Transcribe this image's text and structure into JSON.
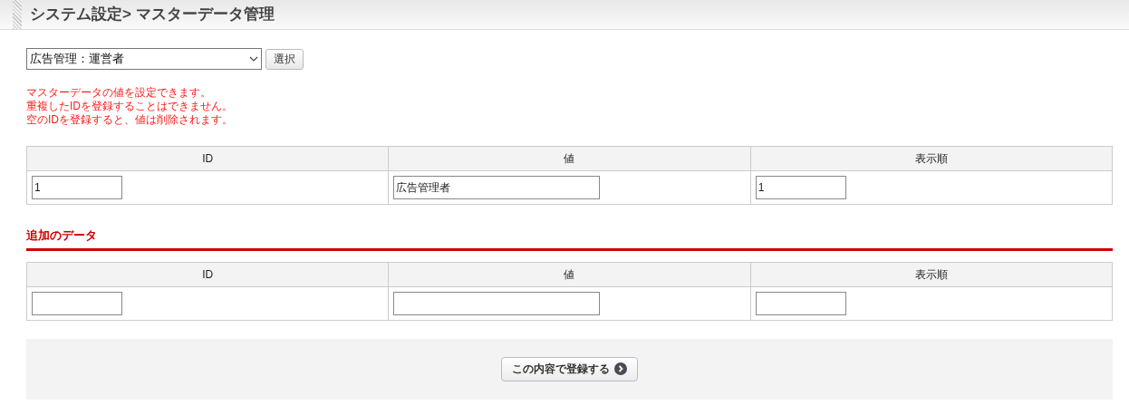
{
  "header": {
    "title": "システム設定> マスターデータ管理"
  },
  "selector": {
    "value": "広告管理：運営者",
    "button": "選択"
  },
  "notes": [
    "マスターデータの値を設定できます。",
    "重複したIDを登録することはできません。",
    "空のIDを登録すると、値は削除されます。"
  ],
  "table": {
    "columns": [
      "ID",
      "値",
      "表示順"
    ],
    "rows": [
      [
        "1",
        "広告管理者",
        "1"
      ]
    ]
  },
  "add_section": {
    "title": "追加のデータ",
    "columns": [
      "ID",
      "値",
      "表示順"
    ]
  },
  "submit": {
    "label": "この内容で登録する"
  }
}
